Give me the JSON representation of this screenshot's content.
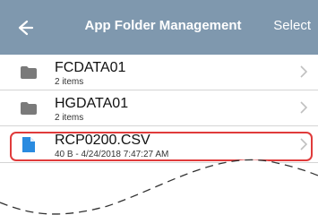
{
  "header": {
    "title": "App Folder Management",
    "select_label": "Select",
    "background_color": "#7f98ae"
  },
  "files": [
    {
      "name": "FCDATA01",
      "detail": "2 items",
      "icon": "folder-icon"
    },
    {
      "name": "HGDATA01",
      "detail": "2 items",
      "icon": "folder-icon"
    },
    {
      "name": "RCP0200.CSV",
      "detail": "40 B - 4/24/2018 7:47:27 AM",
      "icon": "file-icon",
      "highlight_color": "#e03b3b"
    }
  ]
}
